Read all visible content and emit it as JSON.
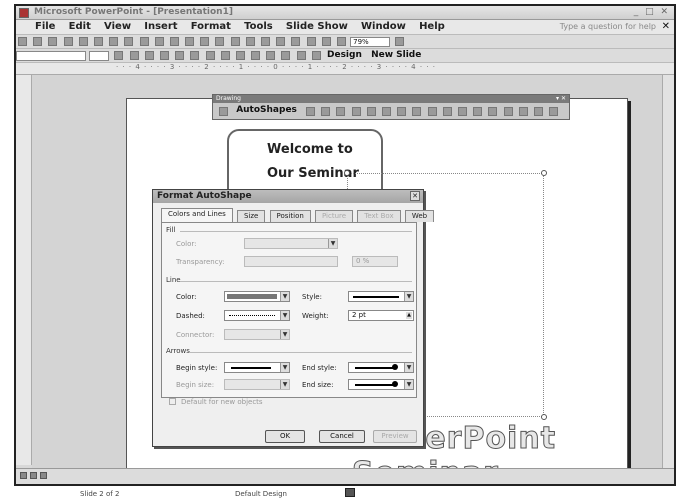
{
  "window": {
    "title": "Microsoft PowerPoint - [Presentation1]",
    "buttons": "_ □ ✕"
  },
  "menubar": {
    "items": [
      "File",
      "Edit",
      "View",
      "Insert",
      "Format",
      "Tools",
      "Slide Show",
      "Window",
      "Help"
    ],
    "help_box": "Type a question for help",
    "close": "✕"
  },
  "toolbar": {
    "zoom": "79%",
    "design_label": "Design",
    "new_slide_label": "New Slide"
  },
  "drawing_toolbar": {
    "title": "Drawing",
    "close": "▾ ✕",
    "autoshapes_label": "AutoShapes"
  },
  "slide": {
    "callout_line1": "Welcome to",
    "callout_line2": "Our Seminar",
    "title_text": "PowerPoint Seminar"
  },
  "dialog": {
    "title": "Format AutoShape",
    "close": "✕",
    "tabs": [
      "Colors and Lines",
      "Size",
      "Position",
      "Picture",
      "Text Box",
      "Web"
    ],
    "fill_group": "Fill",
    "fill_color_label": "Color:",
    "transparency_label": "Transparency:",
    "transparency_value": "0 %",
    "line_group": "Line",
    "line_color_label": "Color:",
    "style_label": "Style:",
    "dashed_label": "Dashed:",
    "weight_label": "Weight:",
    "weight_value": "2 pt",
    "connector_label": "Connector:",
    "arrows_group": "Arrows",
    "begin_style_label": "Begin style:",
    "end_style_label": "End style:",
    "begin_size_label": "Begin size:",
    "end_size_label": "End size:",
    "default_checkbox_label": "Default for new objects",
    "ok_label": "OK",
    "cancel_label": "Cancel",
    "preview_label": "Preview"
  },
  "status": {
    "slide_info": "Slide 2 of 2",
    "design": "Default Design"
  }
}
